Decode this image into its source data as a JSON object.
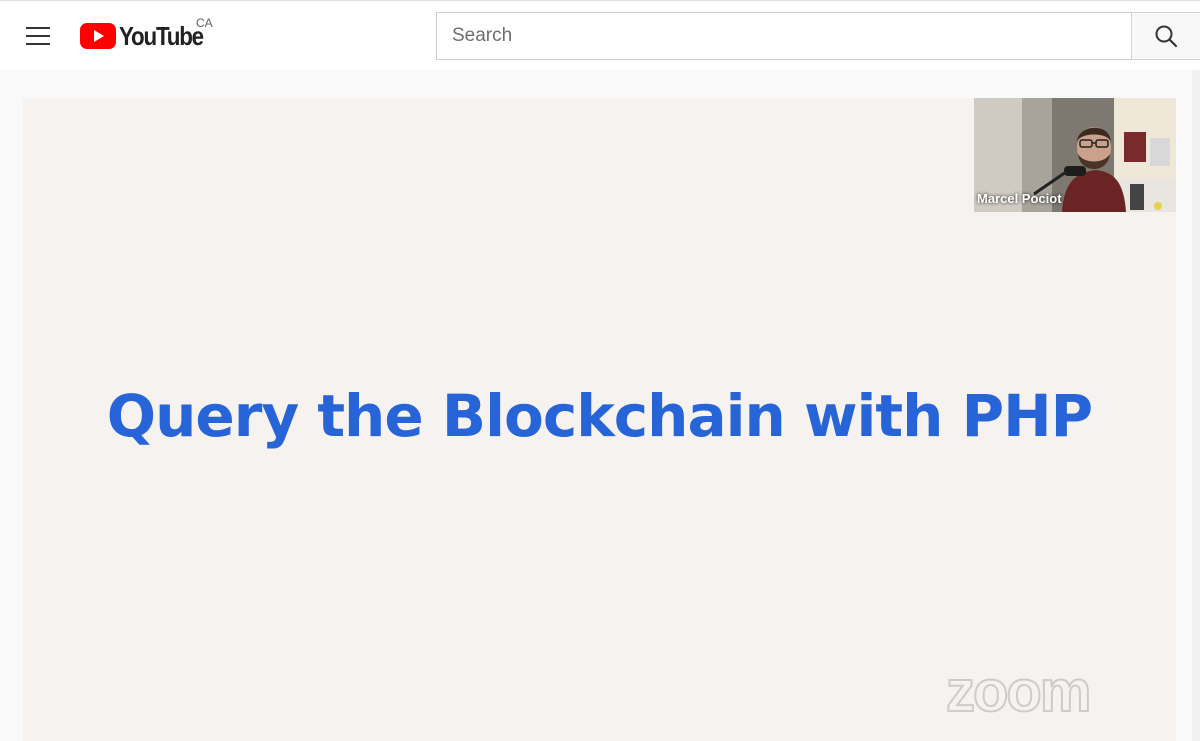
{
  "header": {
    "logo_text": "YouTube",
    "country_code": "CA",
    "search_placeholder": "Search",
    "search_value": ""
  },
  "video": {
    "slide_title": "Query the Blockchain with PHP",
    "speaker_name": "Marcel Pociot",
    "watermark": "zoom"
  },
  "icons": {
    "menu": "hamburger-menu-icon",
    "logo": "youtube-play-icon",
    "search": "magnifier-search-icon"
  },
  "colors": {
    "brand_red": "#ff0000",
    "slide_text": "#2764d8",
    "slide_background": "#f5f2f0"
  }
}
